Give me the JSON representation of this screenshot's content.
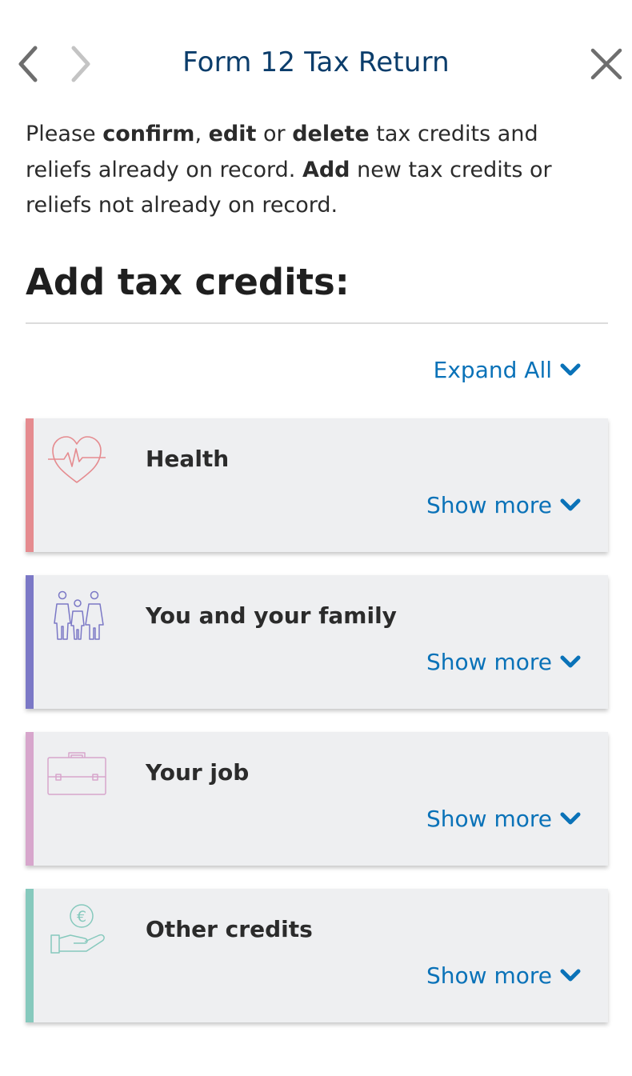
{
  "header": {
    "title": "Form 12 Tax Return",
    "back_icon": "chevron-left-icon",
    "forward_icon": "chevron-right-icon",
    "close_icon": "close-icon"
  },
  "intro": {
    "p1": "Please ",
    "b1": "confirm",
    "p2": ", ",
    "b2": "edit",
    "p3": " or ",
    "b3": "delete",
    "p4": " tax credits and reliefs already on record. ",
    "b4": "Add",
    "p5": " new tax credits or reliefs not already on record."
  },
  "section": {
    "heading": "Add tax credits:",
    "expand_all_label": "Expand All"
  },
  "cards": [
    {
      "title": "Health",
      "show_more": "Show more",
      "icon": "heart-pulse-icon",
      "accent": "#e58b8f"
    },
    {
      "title": "You and your family",
      "show_more": "Show more",
      "icon": "family-icon",
      "accent": "#7b78c6"
    },
    {
      "title": "Your job",
      "show_more": "Show more",
      "icon": "briefcase-icon",
      "accent": "#d7a6cc"
    },
    {
      "title": "Other credits",
      "show_more": "Show more",
      "icon": "euro-hand-icon",
      "accent": "#86c9bd"
    }
  ],
  "colors": {
    "title": "#0b3d6b",
    "link": "#0a72b8",
    "card_bg": "#eeeff1"
  }
}
